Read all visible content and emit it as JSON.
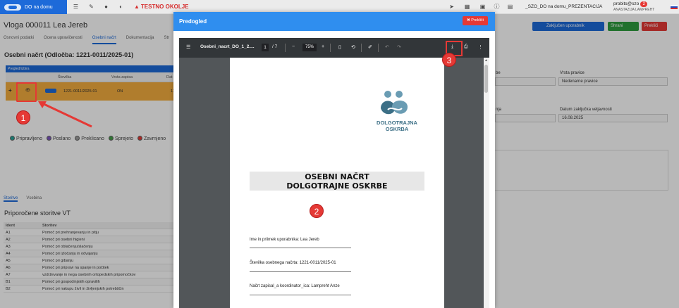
{
  "topbar": {
    "brand": "DO na domu",
    "testno": "TESTNO OKOLJE",
    "presentation": "_SZO_DO na domu_PREZENTACIJA",
    "user": "probits@szo",
    "user_badge": "2",
    "user_sub": "ANASTAZIJA LAMPREHT"
  },
  "page": {
    "title": "Vloga 000011 Lea Jereb",
    "tabs": [
      "Osnovni podatki",
      "Ocena upravičenosti",
      "Osebni načrt",
      "Dokumentacija",
      "Str"
    ],
    "section_title": "Osebni načrt (Odločba: 1221-0011/2025-01)",
    "pregled_label": "Pregled/izbira",
    "cols": [
      "Številka",
      "Vrsta zapisa",
      "Dat"
    ],
    "selected_row": {
      "number": "1221-0011/2025-01",
      "vrsta": "ON",
      "d": "11."
    },
    "legend": [
      {
        "label": "Pripravljeno",
        "color": "#26a69a"
      },
      {
        "label": "Poslano",
        "color": "#7e57c2"
      },
      {
        "label": "Preklicano",
        "color": "#9e9e9e"
      },
      {
        "label": "Sprejeto",
        "color": "#43a047"
      },
      {
        "label": "Zavrnjeno",
        "color": "#e53935"
      }
    ],
    "lower_tabs": [
      "Storitve",
      "Vsebina"
    ],
    "rec_title": "Priporočene storitve VT",
    "rec_headers": [
      "Ident",
      "Storitev"
    ],
    "rec_rows": [
      [
        "A1",
        "Pomoč pri prehranjevanju in pitju"
      ],
      [
        "A2",
        "Pomoč pri osebni higieni"
      ],
      [
        "A3",
        "Pomoč pri oblačenju/slačenju"
      ],
      [
        "A4",
        "Pomoč pri izločanju in odvajanju"
      ],
      [
        "A5",
        "Pomoč pri gibanju"
      ],
      [
        "A6",
        "Pomoč pri pripravi na spanje in počitek"
      ],
      [
        "A7",
        "vzdrževanje in nega osebnih ortopedskih pripomočkov"
      ],
      [
        "B1",
        "Pomoč pri gospodinjskih opravilih"
      ],
      [
        "B2",
        "Pomoč pri nakupu živil in življenjskih potrebščin"
      ]
    ]
  },
  "right": {
    "btn_zakljucen": "Zaključen uporabnik",
    "btn_shrani": "Shrani",
    "btn_preklici": "Prekliči",
    "label_vrsta_pravice_prefix": "be",
    "label_vrsta_pravice": "Vrsta pravice",
    "vrsta_pravice_value": "Nedenarne pravice",
    "label_datum_prefix": "nja",
    "label_datum": "Datum zaključka veljavnosti",
    "datum_value": "16.08.2025"
  },
  "modal": {
    "title": "Predogled",
    "close": "Prekliči",
    "viewer": {
      "filename": "Osebni_nacrt_DO_1_2....",
      "page": "1",
      "pages": "/ 7",
      "zoom": "75%"
    },
    "doc": {
      "logo_line1": "DOLGOTRAJNA",
      "logo_line2": "OSKRBA",
      "banner_line1": "OSEBNI NAČRT",
      "banner_line2": "DOLGOTRAJNE OSKRBE",
      "line1": "Ime in priimek uporabnika: Lea Jereb",
      "line2": "Številka osebnega načrta: 1221-0011/2025-01",
      "line3": "Načrt zapisal_a koordinator_ica: Lampreht Anze"
    }
  },
  "annotations": [
    "1",
    "2",
    "3"
  ],
  "colors": {
    "brand_blue": "#1d6ad9",
    "modal_header": "#2f8eef",
    "selected_row": "#f4ae3f",
    "annotation_red": "#e53935",
    "logo_teal": "#3c6f86"
  }
}
